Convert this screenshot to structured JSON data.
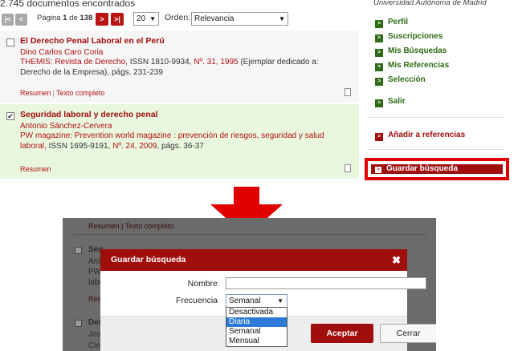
{
  "results_header": {
    "count": "2.745 documentos encontrados",
    "first_icon": "first-page-icon",
    "prev_icon": "prev-page-icon",
    "page_word": "Página",
    "page_current": "1",
    "page_of": "de",
    "page_total": "138",
    "next_icon": "next-page-icon",
    "last_icon": "last-page-icon",
    "per_page": "20",
    "order_label": "Orden:",
    "order_value": "Relevancia"
  },
  "results": [
    {
      "checked": false,
      "title": "El Derecho Penal Laboral en el Perú",
      "author": "Dino Carlos Caro Coria",
      "source_journal": "THEMIS: Revista de Derecho,",
      "source_issn": " ISSN 1810-9934, ",
      "source_issue": "Nº. 31, 1995",
      "source_rest": " (Ejemplar dedicado a: Derecho de la Empresa), págs. 231-239",
      "link_summary": "Resumen",
      "link_fulltext": "Texto completo"
    },
    {
      "checked": true,
      "title": "Seguridad laboral y derecho penal",
      "author": "Antonio Sánchez-Cervera",
      "source_journal": "PW magazine: Prevention world magazine : prevención de riesgos, seguridad y salud laboral,",
      "source_issn": " ISSN 1695-9191, ",
      "source_issue": "Nº. 24, 2009",
      "source_rest": ", págs. 36-37",
      "link_summary": "Resumen"
    }
  ],
  "sidebar": {
    "university": "Universidad Autónoma de Madrid",
    "items": [
      {
        "label": "Perfil"
      },
      {
        "label": "Suscripciones"
      },
      {
        "label": "Mis Búsquedas"
      },
      {
        "label": "Mis Referencias"
      },
      {
        "label": "Selección"
      },
      {
        "label": "Salir"
      }
    ],
    "add_references": "Añadir a referencias",
    "save_search": "Guardar búsqueda"
  },
  "background_page": {
    "links_row": "Resumen | Texto completo",
    "row_prefix_1": "Seg",
    "row_prefix_2": "Ant",
    "row_prefix_3": "PW",
    "row_prefix_4": "labo",
    "row_prefix_5": "Res",
    "row_prefix_6": "Der",
    "row_prefix_7": "Jos",
    "row_prefix_8": "Cie"
  },
  "dialog": {
    "title": "Guardar búsqueda",
    "close_icon": "close-icon",
    "name_label": "Nombre",
    "name_value": "",
    "frequency_label": "Frecuencia",
    "frequency_value": "Semanal",
    "frequency_options": [
      "Desactivada",
      "Diaria",
      "Semanal",
      "Mensual"
    ],
    "frequency_highlighted": "Diaria",
    "accept": "Aceptar",
    "cancel": "Cerrar"
  },
  "colors": {
    "brand_red": "#a00d0d",
    "sidebar_green": "#2e6b16",
    "highlight_red": "#e00000",
    "selected_bg": "#e9f7df",
    "dropdown_highlight": "#2a7ad6"
  }
}
